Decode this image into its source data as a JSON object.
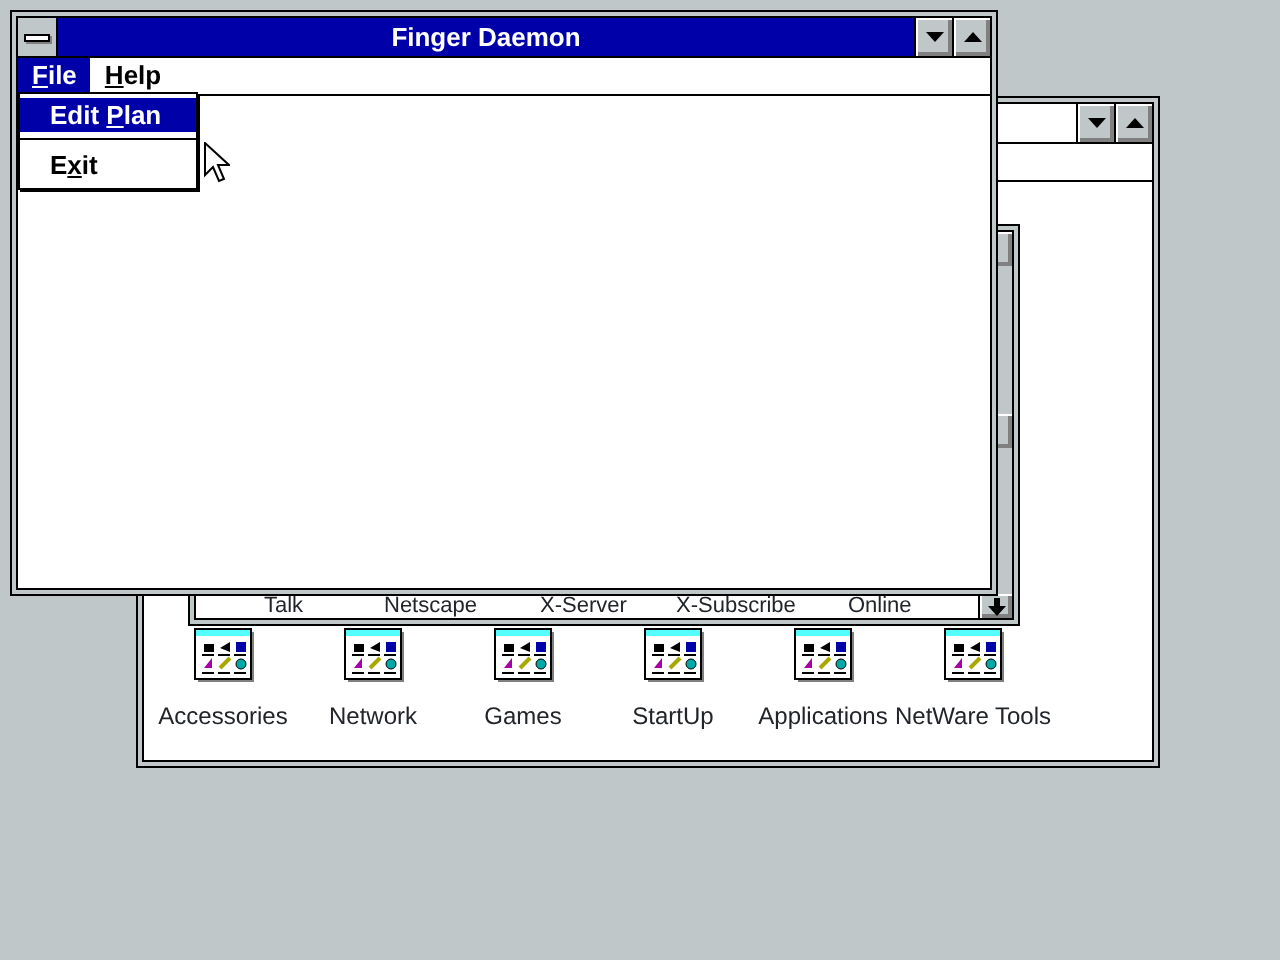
{
  "finger_window": {
    "title": "Finger Daemon",
    "menu": [
      {
        "access_key": "F",
        "label_rest": "ile",
        "selected": true
      },
      {
        "access_key": "H",
        "label_rest": "elp",
        "selected": false
      }
    ],
    "file_menu": [
      {
        "label_lead": "Edit ",
        "access_key": "P",
        "label_rest": "lan",
        "selected": true
      },
      {
        "label_lead": "E",
        "access_key": "x",
        "label_rest": "it",
        "selected": false
      }
    ]
  },
  "program_manager": {
    "group_window": {
      "items": [
        "Talk",
        "Netscape",
        "X-Server",
        "X-Subscribe",
        "Online"
      ]
    },
    "groups": [
      {
        "label": "Accessories"
      },
      {
        "label": "Network"
      },
      {
        "label": "Games"
      },
      {
        "label": "StartUp"
      },
      {
        "label": "Applications"
      },
      {
        "label": "NetWare Tools"
      }
    ]
  }
}
